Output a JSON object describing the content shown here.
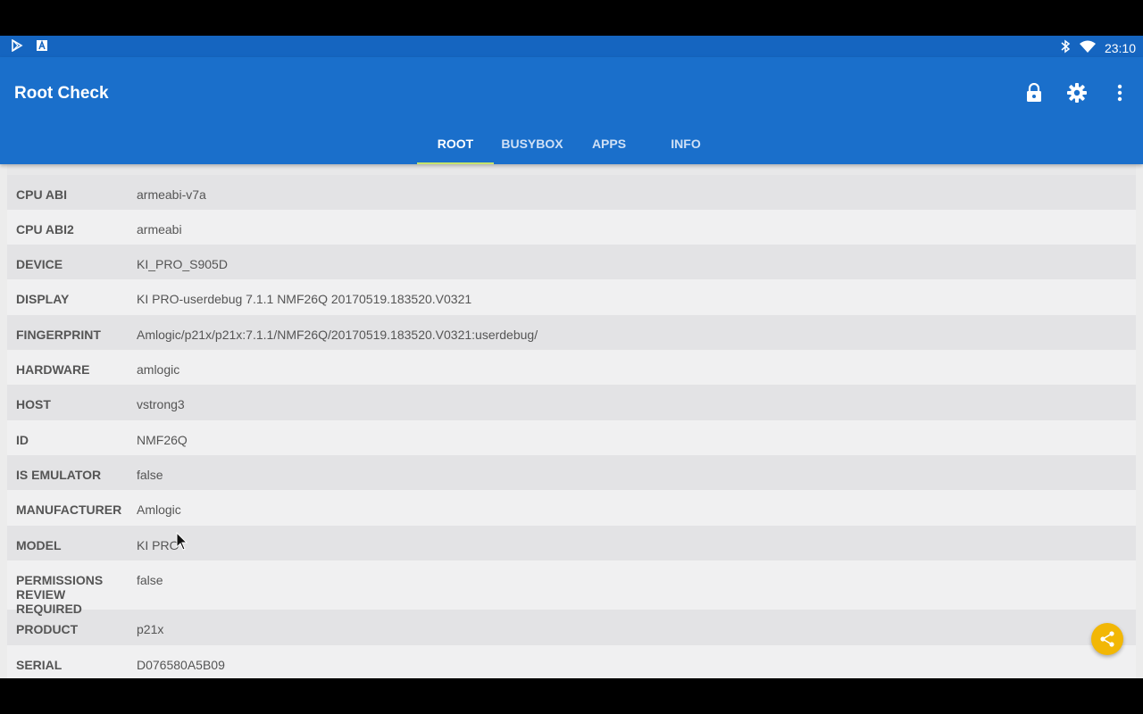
{
  "statusbar": {
    "time": "23:10",
    "left_icons": [
      "play-store-icon",
      "font-icon"
    ],
    "right_icons": [
      "bluetooth-icon",
      "wifi-icon"
    ]
  },
  "appbar": {
    "title": "Root Check",
    "actions": [
      "lock-icon",
      "settings-icon",
      "more-vert-icon"
    ],
    "color": "#1a6fcb"
  },
  "tabs": [
    {
      "label": "ROOT",
      "active": true
    },
    {
      "label": "BUSYBOX",
      "active": false
    },
    {
      "label": "APPS",
      "active": false
    },
    {
      "label": "INFO",
      "active": false
    }
  ],
  "info_rows": [
    {
      "key": "CPU ABI",
      "value": "armeabi-v7a"
    },
    {
      "key": "CPU ABI2",
      "value": "armeabi"
    },
    {
      "key": "DEVICE",
      "value": "KI_PRO_S905D"
    },
    {
      "key": "DISPLAY",
      "value": "KI PRO-userdebug 7.1.1 NMF26Q 20170519.183520.V0321"
    },
    {
      "key": "FINGERPRINT",
      "value": "Amlogic/p21x/p21x:7.1.1/NMF26Q/20170519.183520.V0321:userdebug/"
    },
    {
      "key": "HARDWARE",
      "value": "amlogic"
    },
    {
      "key": "HOST",
      "value": "vstrong3"
    },
    {
      "key": "ID",
      "value": "NMF26Q"
    },
    {
      "key": "IS EMULATOR",
      "value": "false"
    },
    {
      "key": "MANUFACTURER",
      "value": "Amlogic"
    },
    {
      "key": "MODEL",
      "value": "KI PRO"
    },
    {
      "key": "PERMISSIONS REVIEW REQUIRED",
      "value": "false"
    },
    {
      "key": "PRODUCT",
      "value": "p21x"
    },
    {
      "key": "SERIAL",
      "value": "D076580A5B09"
    }
  ],
  "fab": {
    "icon": "share-icon",
    "color": "#f2b705"
  }
}
